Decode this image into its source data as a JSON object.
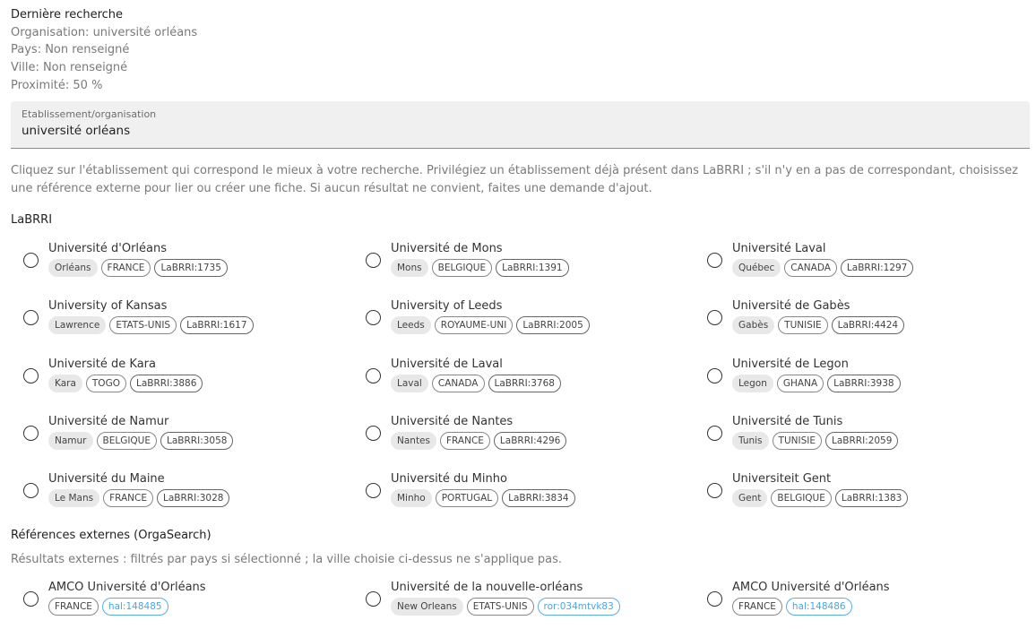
{
  "summary": {
    "title": "Dernière recherche",
    "organisation": "Organisation: université orléans",
    "pays": "Pays: Non renseigné",
    "ville": "Ville: Non renseigné",
    "proximite": "Proximité: 50 %"
  },
  "search": {
    "label": "Etablissement/organisation",
    "value": "université orléans"
  },
  "help_text": "Cliquez sur l'établissement qui correspond le mieux à votre recherche. Privilégiez un établissement déjà présent dans LaBRRI ; s'il n'y en a pas de correspondant, choisissez une référence externe pour lier ou créer une fiche. Si aucun résultat ne convient, faites une demande d'ajout.",
  "labrri": {
    "title": "LaBRRI",
    "items": [
      {
        "name": "Université d'Orléans",
        "city": "Orléans",
        "country": "FRANCE",
        "ref": "LaBRRI:1735"
      },
      {
        "name": "Université de Mons",
        "city": "Mons",
        "country": "BELGIQUE",
        "ref": "LaBRRI:1391"
      },
      {
        "name": "Université Laval",
        "city": "Québec",
        "country": "CANADA",
        "ref": "LaBRRI:1297"
      },
      {
        "name": "University of Kansas",
        "city": "Lawrence",
        "country": "ETATS-UNIS",
        "ref": "LaBRRI:1617"
      },
      {
        "name": "University of Leeds",
        "city": "Leeds",
        "country": "ROYAUME-UNI",
        "ref": "LaBRRI:2005"
      },
      {
        "name": "Université de Gabès",
        "city": "Gabès",
        "country": "TUNISIE",
        "ref": "LaBRRI:4424"
      },
      {
        "name": "Université de Kara",
        "city": "Kara",
        "country": "TOGO",
        "ref": "LaBRRI:3886"
      },
      {
        "name": "Université de Laval",
        "city": "Laval",
        "country": "CANADA",
        "ref": "LaBRRI:3768"
      },
      {
        "name": "Université de Legon",
        "city": "Legon",
        "country": "GHANA",
        "ref": "LaBRRI:3938"
      },
      {
        "name": "Université de Namur",
        "city": "Namur",
        "country": "BELGIQUE",
        "ref": "LaBRRI:3058"
      },
      {
        "name": "Université de Nantes",
        "city": "Nantes",
        "country": "FRANCE",
        "ref": "LaBRRI:4296"
      },
      {
        "name": "Université de Tunis",
        "city": "Tunis",
        "country": "TUNISIE",
        "ref": "LaBRRI:2059"
      },
      {
        "name": "Université du Maine",
        "city": "Le Mans",
        "country": "FRANCE",
        "ref": "LaBRRI:3028"
      },
      {
        "name": "Université du Minho",
        "city": "Minho",
        "country": "PORTUGAL",
        "ref": "LaBRRI:3834"
      },
      {
        "name": "Universiteit Gent",
        "city": "Gent",
        "country": "BELGIQUE",
        "ref": "LaBRRI:1383"
      }
    ]
  },
  "external": {
    "title": "Références externes (OrgaSearch)",
    "note": "Résultats externes : filtrés par pays si sélectionné ; la ville choisie ci-dessus ne s'applique pas.",
    "items": [
      {
        "name": "AMCO Université d'Orléans",
        "city": "",
        "country": "FRANCE",
        "ref": "hal:148485"
      },
      {
        "name": "Université de la nouvelle-orléans",
        "city": "New Orleans",
        "country": "ETATS-UNIS",
        "ref": "ror:034mtvk83"
      },
      {
        "name": "AMCO Université d'Orléans",
        "city": "",
        "country": "FRANCE",
        "ref": "hal:148486"
      }
    ]
  },
  "colors": {
    "external_ref": "#4aa6e0",
    "field_bg": "#f0f0f0",
    "muted_text": "#7a7a7a"
  }
}
